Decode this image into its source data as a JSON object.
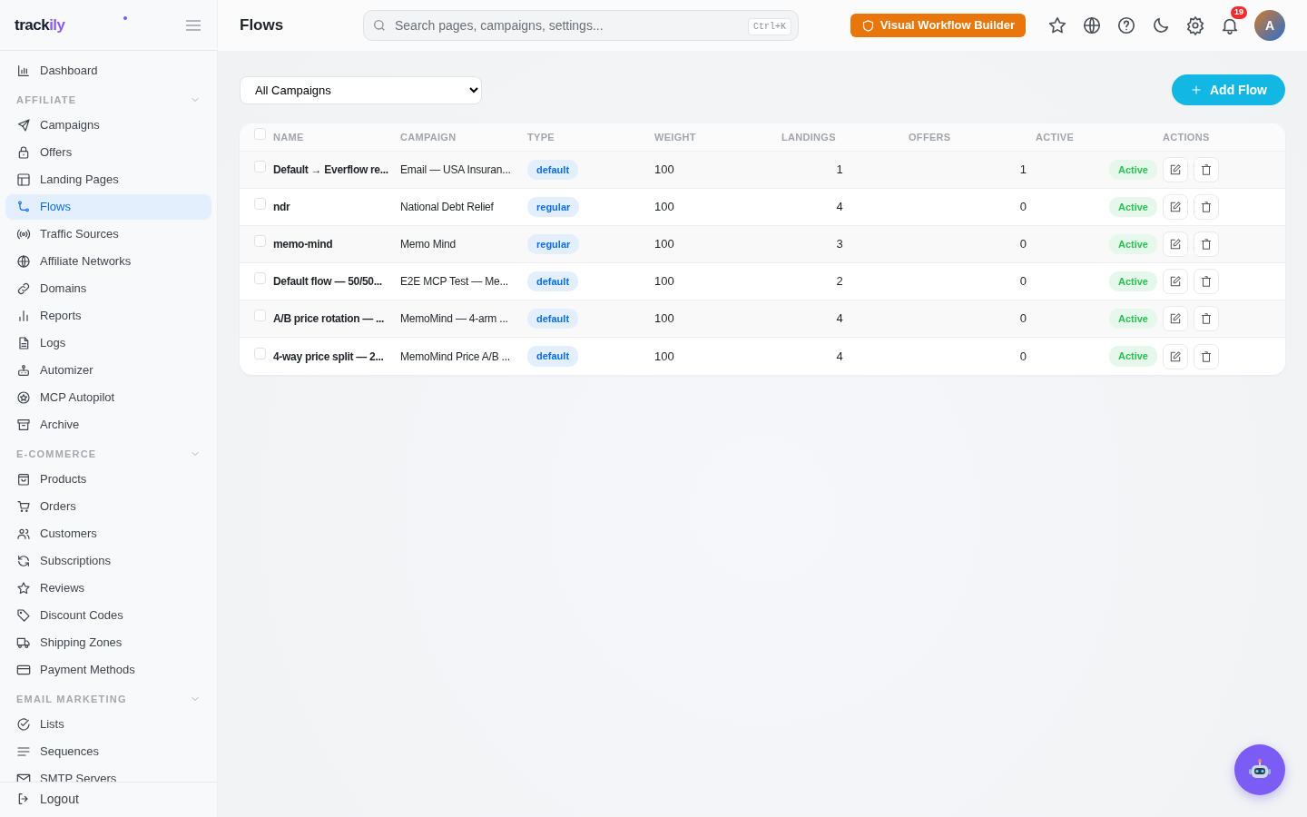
{
  "sidebar": {
    "logo": {
      "text": "track",
      "accent": "ily"
    },
    "top_item": {
      "label": "Dashboard",
      "selected": false
    },
    "sections": [
      {
        "title": "AFFILIATE",
        "expanded": true,
        "items": [
          {
            "label": "Campaigns",
            "selected": false
          },
          {
            "label": "Offers",
            "selected": false
          },
          {
            "label": "Landing Pages",
            "selected": false
          },
          {
            "label": "Flows",
            "selected": true
          },
          {
            "label": "Traffic Sources",
            "selected": false
          },
          {
            "label": "Affiliate Networks",
            "selected": false
          },
          {
            "label": "Domains",
            "selected": false
          },
          {
            "label": "Reports",
            "selected": false
          },
          {
            "label": "Logs",
            "selected": false
          },
          {
            "label": "Automizer",
            "selected": false
          },
          {
            "label": "MCP Autopilot",
            "selected": false
          },
          {
            "label": "Archive",
            "selected": false
          }
        ]
      },
      {
        "title": "E-COMMERCE",
        "expanded": true,
        "items": [
          {
            "label": "Products",
            "selected": false
          },
          {
            "label": "Orders",
            "selected": false
          },
          {
            "label": "Customers",
            "selected": false
          },
          {
            "label": "Subscriptions",
            "selected": false
          },
          {
            "label": "Reviews",
            "selected": false
          },
          {
            "label": "Discount Codes",
            "selected": false
          },
          {
            "label": "Shipping Zones",
            "selected": false
          },
          {
            "label": "Payment Methods",
            "selected": false
          }
        ]
      },
      {
        "title": "EMAIL MARKETING",
        "expanded": true,
        "items": [
          {
            "label": "Lists",
            "selected": false
          },
          {
            "label": "Sequences",
            "selected": false
          },
          {
            "label": "SMTP Servers",
            "selected": false
          }
        ]
      }
    ],
    "logout": "Logout"
  },
  "header": {
    "title": "Flows",
    "search": {
      "placeholder": "Search pages, campaigns, settings...",
      "shortcut": "Ctrl+K"
    },
    "builder_button": "Visual Workflow Builder",
    "notifications": "19",
    "avatar": "A"
  },
  "toolbar": {
    "filter": "All Campaigns",
    "add_button": "Add Flow"
  },
  "table": {
    "all_checked": false,
    "columns": [
      "NAME",
      "CAMPAIGN",
      "TYPE",
      "WEIGHT",
      "LANDINGS",
      "OFFERS",
      "ACTIVE",
      "ACTIONS"
    ],
    "rows": [
      {
        "checked": false,
        "name": "Default → Everflow re...",
        "campaign": "Email — USA Insuran...",
        "type": "default",
        "weight": "100",
        "landings": "1",
        "offers": "1",
        "status": {
          "label": "Active",
          "active": true
        }
      },
      {
        "checked": false,
        "name": "ndr",
        "campaign": "National Debt Relief",
        "type": "regular",
        "weight": "100",
        "landings": "4",
        "offers": "0",
        "status": {
          "label": "Active",
          "active": true
        }
      },
      {
        "checked": false,
        "name": "memo-mind",
        "campaign": "Memo Mind",
        "type": "regular",
        "weight": "100",
        "landings": "3",
        "offers": "0",
        "status": {
          "label": "Active",
          "active": true
        }
      },
      {
        "checked": false,
        "name": "Default flow — 50/50...",
        "campaign": "E2E MCP Test — Me...",
        "type": "default",
        "weight": "100",
        "landings": "2",
        "offers": "0",
        "status": {
          "label": "Active",
          "active": true
        }
      },
      {
        "checked": false,
        "name": "A/B price rotation — ...",
        "campaign": "MemoMind — 4-arm ...",
        "type": "default",
        "weight": "100",
        "landings": "4",
        "offers": "0",
        "status": {
          "label": "Active",
          "active": true
        }
      },
      {
        "checked": false,
        "name": "4-way price split — 2...",
        "campaign": "MemoMind Price A/B ...",
        "type": "default",
        "weight": "100",
        "landings": "4",
        "offers": "0",
        "status": {
          "label": "Active",
          "active": true
        }
      }
    ]
  }
}
